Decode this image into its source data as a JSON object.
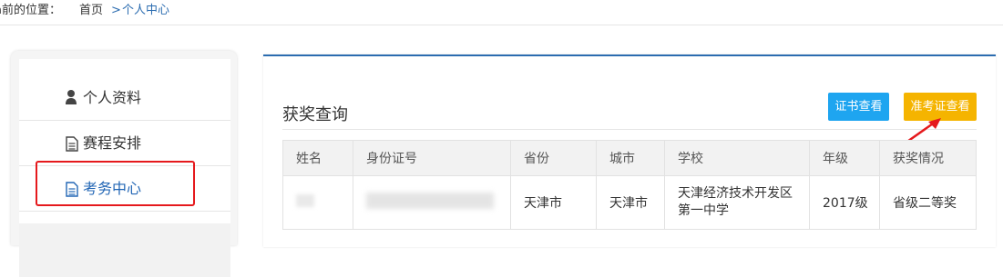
{
  "breadcrumb": {
    "prefix": "á前的位置：",
    "home": "首页",
    "separator": ">",
    "current": "个人中心"
  },
  "sidebar": {
    "items": [
      {
        "label": "个人资料",
        "icon": "user-icon",
        "active": false
      },
      {
        "label": "赛程安排",
        "icon": "document-icon",
        "active": false
      },
      {
        "label": "考务中心",
        "icon": "document-icon",
        "active": true
      }
    ]
  },
  "panel": {
    "title": "获奖查询",
    "buttons": {
      "cert": "证书查看",
      "admit": "准考证查看"
    }
  },
  "table": {
    "headers": [
      "姓名",
      "身份证号",
      "省份",
      "城市",
      "学校",
      "年级",
      "获奖情况"
    ],
    "rows": [
      {
        "name": "",
        "id": "",
        "province": "天津市",
        "city": "天津市",
        "school": "天津经济技术开发区第一中学",
        "grade": "2017级",
        "award": "省级二等奖"
      }
    ]
  },
  "colors": {
    "accent_blue": "#2b6cb0",
    "cert_button": "#1ea5f0",
    "admit_button": "#f5b400",
    "highlight_red": "#e5191d"
  }
}
